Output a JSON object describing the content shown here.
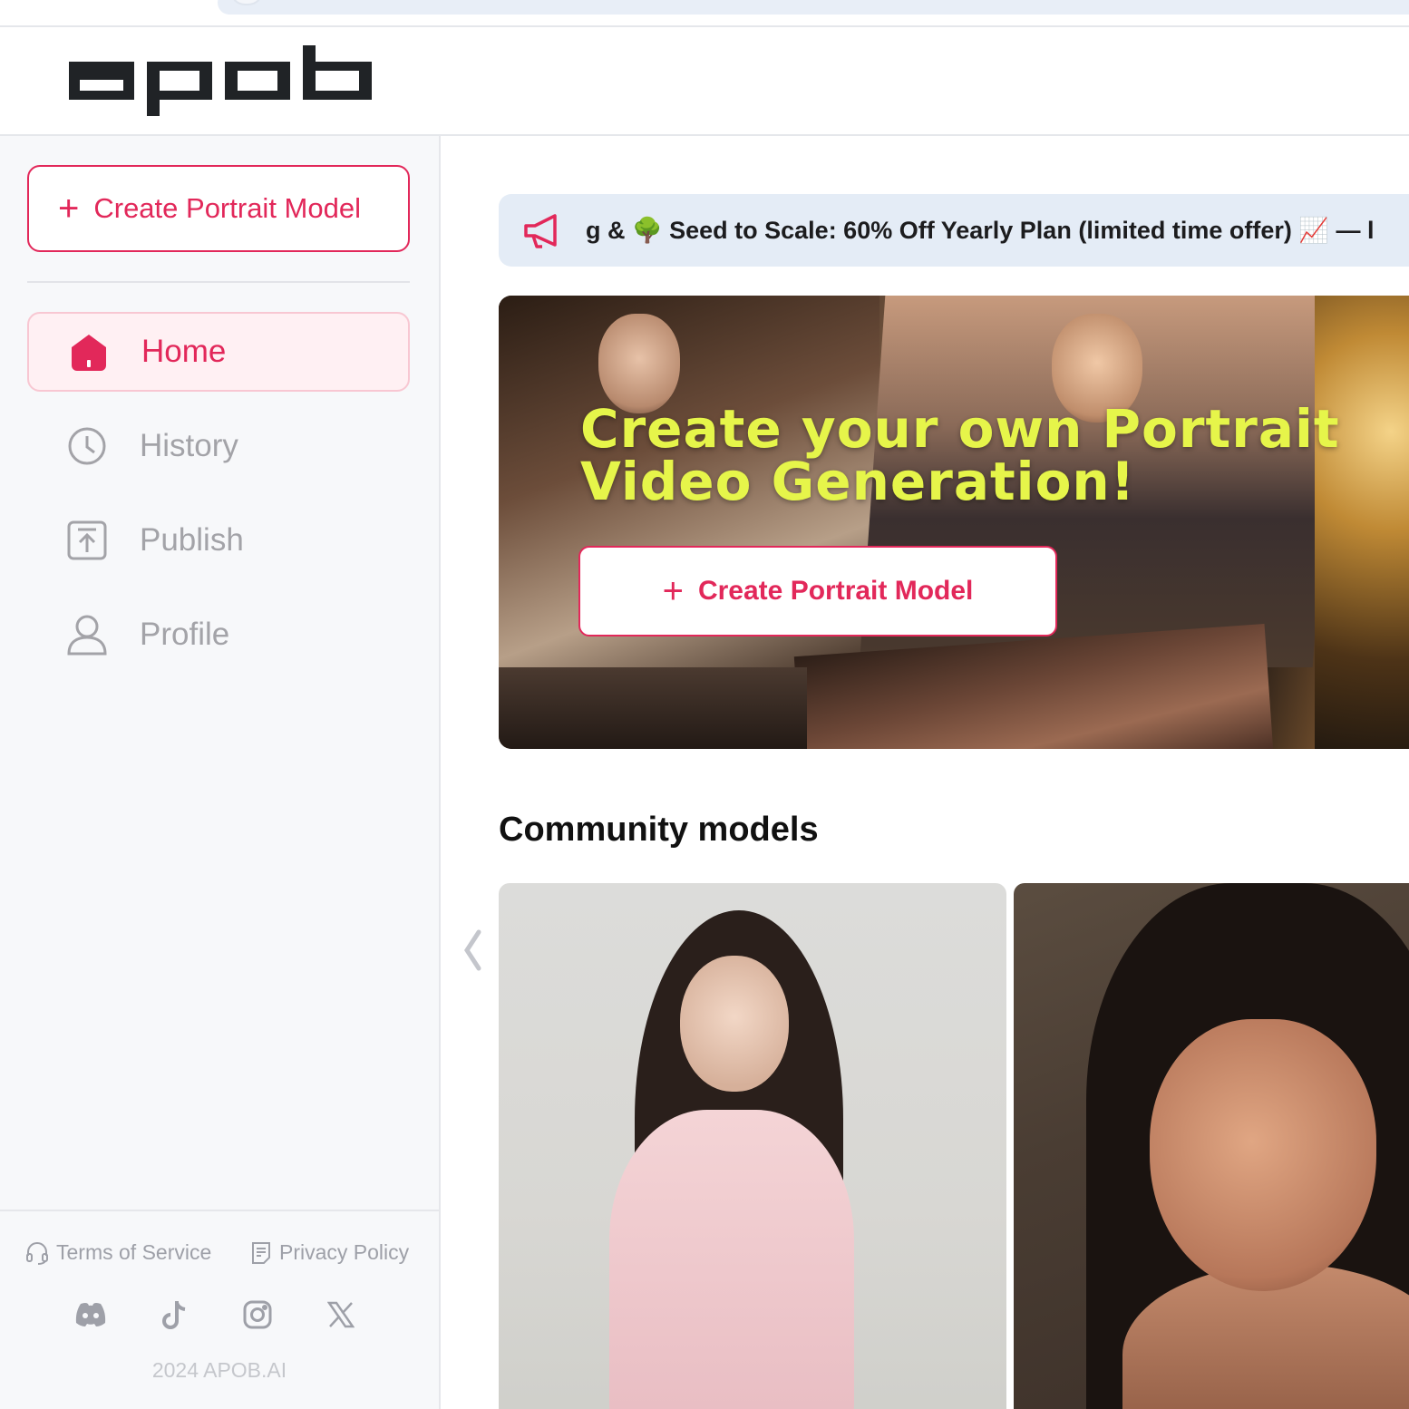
{
  "app": {
    "logo_text": "apob"
  },
  "sidebar": {
    "create_button": {
      "icon": "plus-icon",
      "label": "Create Portrait Model"
    },
    "items": [
      {
        "icon": "home-icon",
        "label": "Home",
        "active": true
      },
      {
        "icon": "clock-icon",
        "label": "History",
        "active": false
      },
      {
        "icon": "upload-icon",
        "label": "Publish",
        "active": false
      },
      {
        "icon": "user-icon",
        "label": "Profile",
        "active": false
      }
    ],
    "footer": {
      "terms": {
        "icon": "headset-icon",
        "label": "Terms of Service"
      },
      "privacy": {
        "icon": "document-icon",
        "label": "Privacy Policy"
      },
      "social": [
        "discord-icon",
        "tiktok-icon",
        "instagram-icon",
        "x-icon"
      ],
      "copyright": "2024 APOB.AI"
    }
  },
  "announcement": {
    "icon": "megaphone-icon",
    "text": "g & 🌳 Seed to Scale: 60% Off Yearly Plan (limited time offer) 📈 — l"
  },
  "hero": {
    "title": "Create your own Portrait Video Generation!",
    "cta_label": "Create Portrait Model",
    "cta_icon": "plus-icon"
  },
  "community": {
    "title": "Community models",
    "scroll_icon": "chevron-left-icon"
  },
  "colors": {
    "accent": "#e2285a",
    "hero_title": "#e6f54a",
    "sidebar_bg": "#f7f8fa",
    "announce_bg": "#e4ecf6"
  }
}
